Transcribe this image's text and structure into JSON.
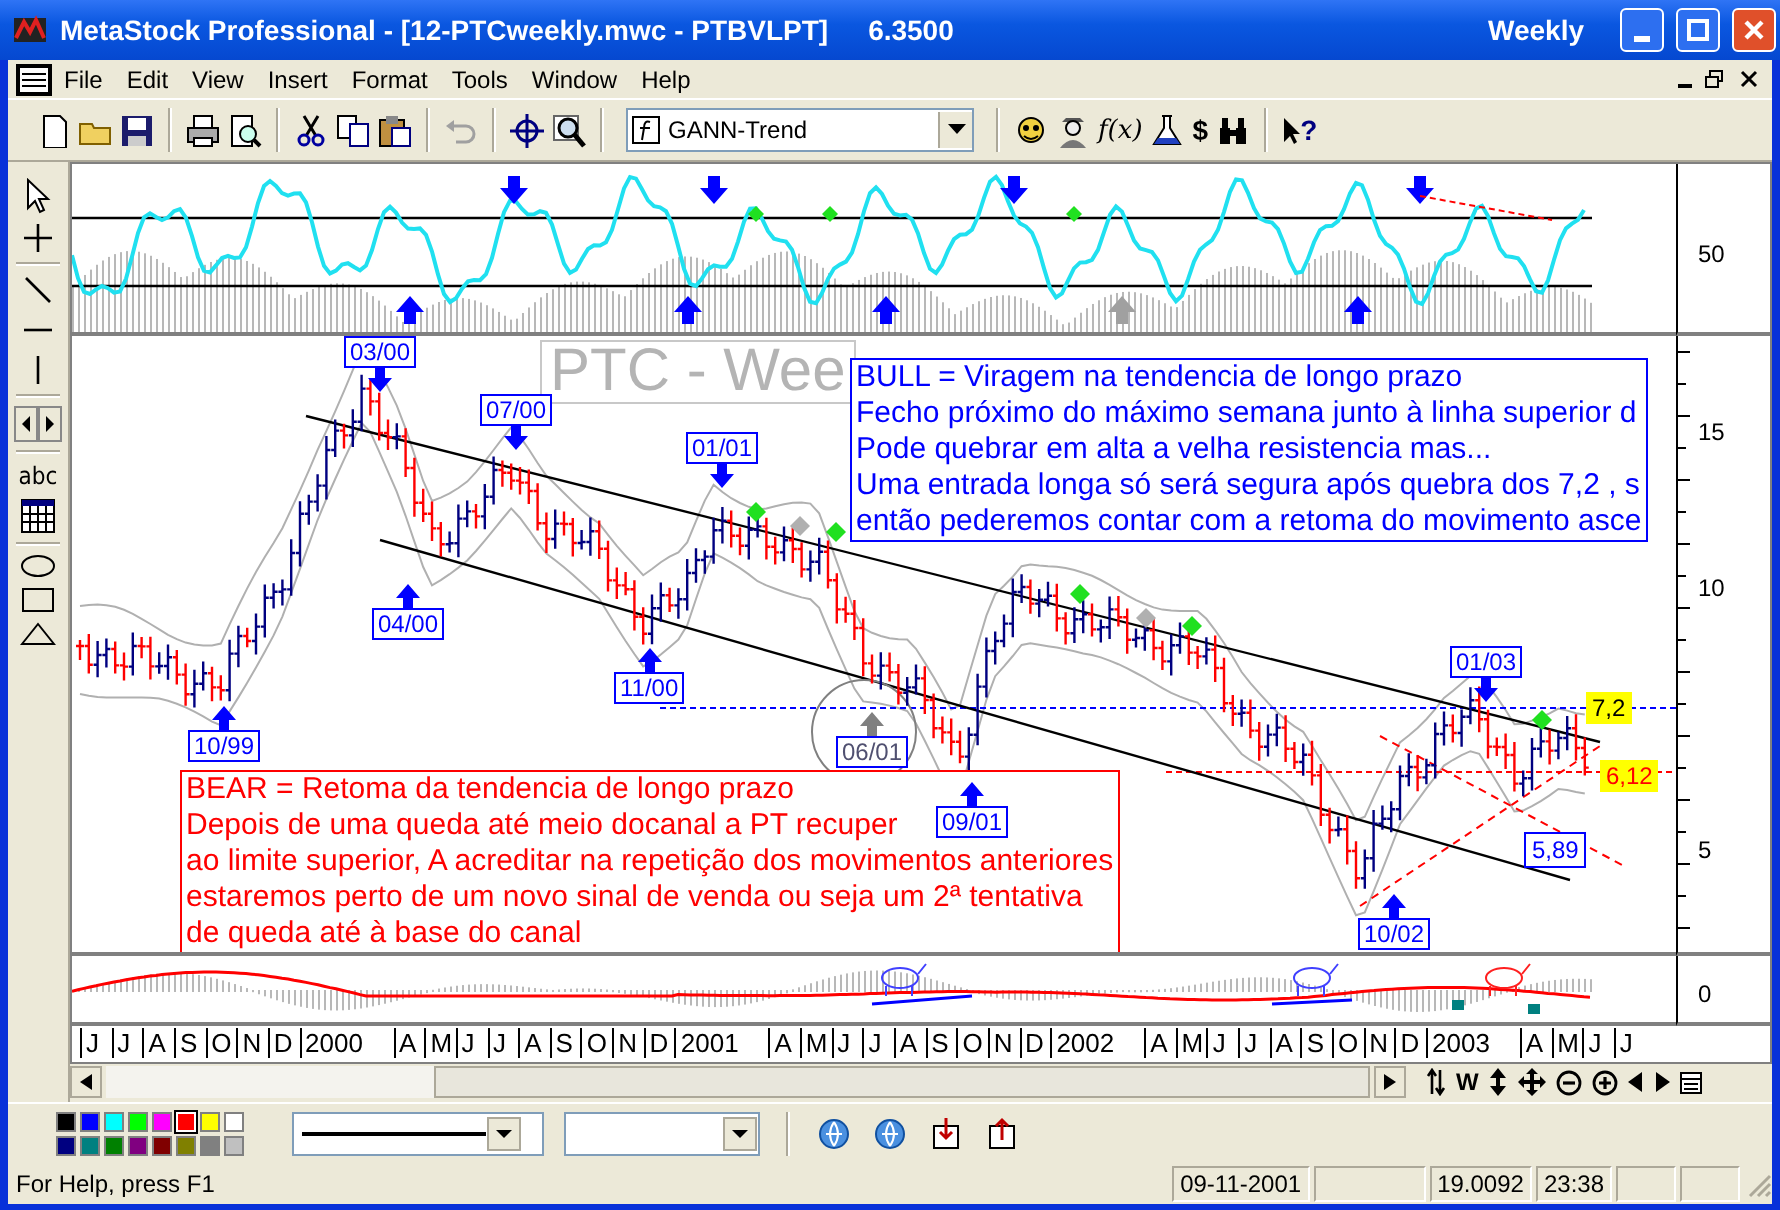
{
  "window": {
    "title": "MetaStock Professional - [12-PTCweekly.mwc - PTBVLPT]",
    "price": "6.3500",
    "period": "Weekly"
  },
  "menu": [
    "File",
    "Edit",
    "View",
    "Insert",
    "Format",
    "Tools",
    "Window",
    "Help"
  ],
  "toolbar": {
    "template": "GANN-Trend",
    "function_glyph": "f(x)",
    "dollar_glyph": "$",
    "help_glyph": "?"
  },
  "toolbox": {
    "text_tool": "abc"
  },
  "oscillator_pane": {
    "axis_labels": [
      "50"
    ]
  },
  "price_pane": {
    "watermark": "PTC - Wee",
    "axis_labels": [
      "15",
      "10",
      "5"
    ],
    "markers": [
      {
        "label": "10/99",
        "kind": "bottom",
        "faded": false
      },
      {
        "label": "03/00",
        "kind": "top",
        "faded": false
      },
      {
        "label": "04/00",
        "kind": "bottom",
        "faded": false
      },
      {
        "label": "07/00",
        "kind": "top",
        "faded": false
      },
      {
        "label": "11/00",
        "kind": "bottom",
        "faded": false
      },
      {
        "label": "01/01",
        "kind": "top",
        "faded": false
      },
      {
        "label": "06/01",
        "kind": "bottom",
        "faded": true
      },
      {
        "label": "09/01",
        "kind": "bottom",
        "faded": false
      },
      {
        "label": "10/02",
        "kind": "bottom",
        "faded": false
      },
      {
        "label": "01/03",
        "kind": "top",
        "faded": false
      }
    ],
    "notes": [
      {
        "kind": "bull",
        "lines": [
          "BULL = Viragem na tendencia de longo prazo",
          "Fecho próximo do máximo semana junto à linha superior d",
          "Pode quebrar em alta a velha resistencia mas...",
          "Uma entrada longa só será segura após quebra dos 7,2 , s",
          "então pederemos contar com a retoma do movimento asce"
        ]
      },
      {
        "kind": "bear",
        "lines": [
          "BEAR = Retoma da tendencia de longo prazo",
          "Depois de uma queda até meio docanal a PT recuper",
          "ao limite superior, A acreditar na repetição dos movimentos anteriores",
          "estaremos perto de um novo sinal de venda ou seja um 2ª tentativa",
          "de queda até à base do canal"
        ]
      }
    ],
    "price_tags": [
      {
        "text": "7,2",
        "kind": "highlight"
      },
      {
        "text": "6,12",
        "kind": "alert"
      },
      {
        "text": "5,89",
        "kind": "boxed"
      }
    ]
  },
  "volume_pane": {
    "axis_labels": [
      "0"
    ]
  },
  "time_axis": [
    {
      "label": "J",
      "kind": "month"
    },
    {
      "label": "J",
      "kind": "month"
    },
    {
      "label": "A",
      "kind": "month"
    },
    {
      "label": "S",
      "kind": "month"
    },
    {
      "label": "O",
      "kind": "month"
    },
    {
      "label": "N",
      "kind": "month"
    },
    {
      "label": "D",
      "kind": "month"
    },
    {
      "label": "2000",
      "kind": "year"
    },
    {
      "label": "A",
      "kind": "month"
    },
    {
      "label": "M",
      "kind": "month"
    },
    {
      "label": "J",
      "kind": "month"
    },
    {
      "label": "J",
      "kind": "month"
    },
    {
      "label": "A",
      "kind": "month"
    },
    {
      "label": "S",
      "kind": "month"
    },
    {
      "label": "O",
      "kind": "month"
    },
    {
      "label": "N",
      "kind": "month"
    },
    {
      "label": "D",
      "kind": "month"
    },
    {
      "label": "2001",
      "kind": "year"
    },
    {
      "label": "A",
      "kind": "month"
    },
    {
      "label": "M",
      "kind": "month"
    },
    {
      "label": "J",
      "kind": "month"
    },
    {
      "label": "J",
      "kind": "month"
    },
    {
      "label": "A",
      "kind": "month"
    },
    {
      "label": "S",
      "kind": "month"
    },
    {
      "label": "O",
      "kind": "month"
    },
    {
      "label": "N",
      "kind": "month"
    },
    {
      "label": "D",
      "kind": "month"
    },
    {
      "label": "2002",
      "kind": "year"
    },
    {
      "label": "A",
      "kind": "month"
    },
    {
      "label": "M",
      "kind": "month"
    },
    {
      "label": "J",
      "kind": "month"
    },
    {
      "label": "J",
      "kind": "month"
    },
    {
      "label": "A",
      "kind": "month"
    },
    {
      "label": "S",
      "kind": "month"
    },
    {
      "label": "O",
      "kind": "month"
    },
    {
      "label": "N",
      "kind": "month"
    },
    {
      "label": "D",
      "kind": "month"
    },
    {
      "label": "2003",
      "kind": "year"
    },
    {
      "label": "A",
      "kind": "month"
    },
    {
      "label": "M",
      "kind": "month"
    },
    {
      "label": "J",
      "kind": "month"
    },
    {
      "label": "J",
      "kind": "month"
    }
  ],
  "navigation": {
    "week_button": "W"
  },
  "palette": [
    {
      "color": "#000000",
      "selected": false
    },
    {
      "color": "#0000ff",
      "selected": false
    },
    {
      "color": "#00ffff",
      "selected": false
    },
    {
      "color": "#00ff00",
      "selected": false
    },
    {
      "color": "#ff00ff",
      "selected": false
    },
    {
      "color": "#ff0000",
      "selected": true
    },
    {
      "color": "#ffff00",
      "selected": false
    },
    {
      "color": "#ffffff",
      "selected": false
    },
    {
      "color": "#000080",
      "selected": false
    },
    {
      "color": "#008080",
      "selected": false
    },
    {
      "color": "#008000",
      "selected": false
    },
    {
      "color": "#800080",
      "selected": false
    },
    {
      "color": "#800000",
      "selected": false
    },
    {
      "color": "#808000",
      "selected": false
    },
    {
      "color": "#808080",
      "selected": false
    },
    {
      "color": "#c0c0c0",
      "selected": false
    }
  ],
  "status_bar": {
    "help": "For Help, press F1",
    "panes": [
      "09-11-2001",
      "19.0092",
      "23:38"
    ]
  }
}
